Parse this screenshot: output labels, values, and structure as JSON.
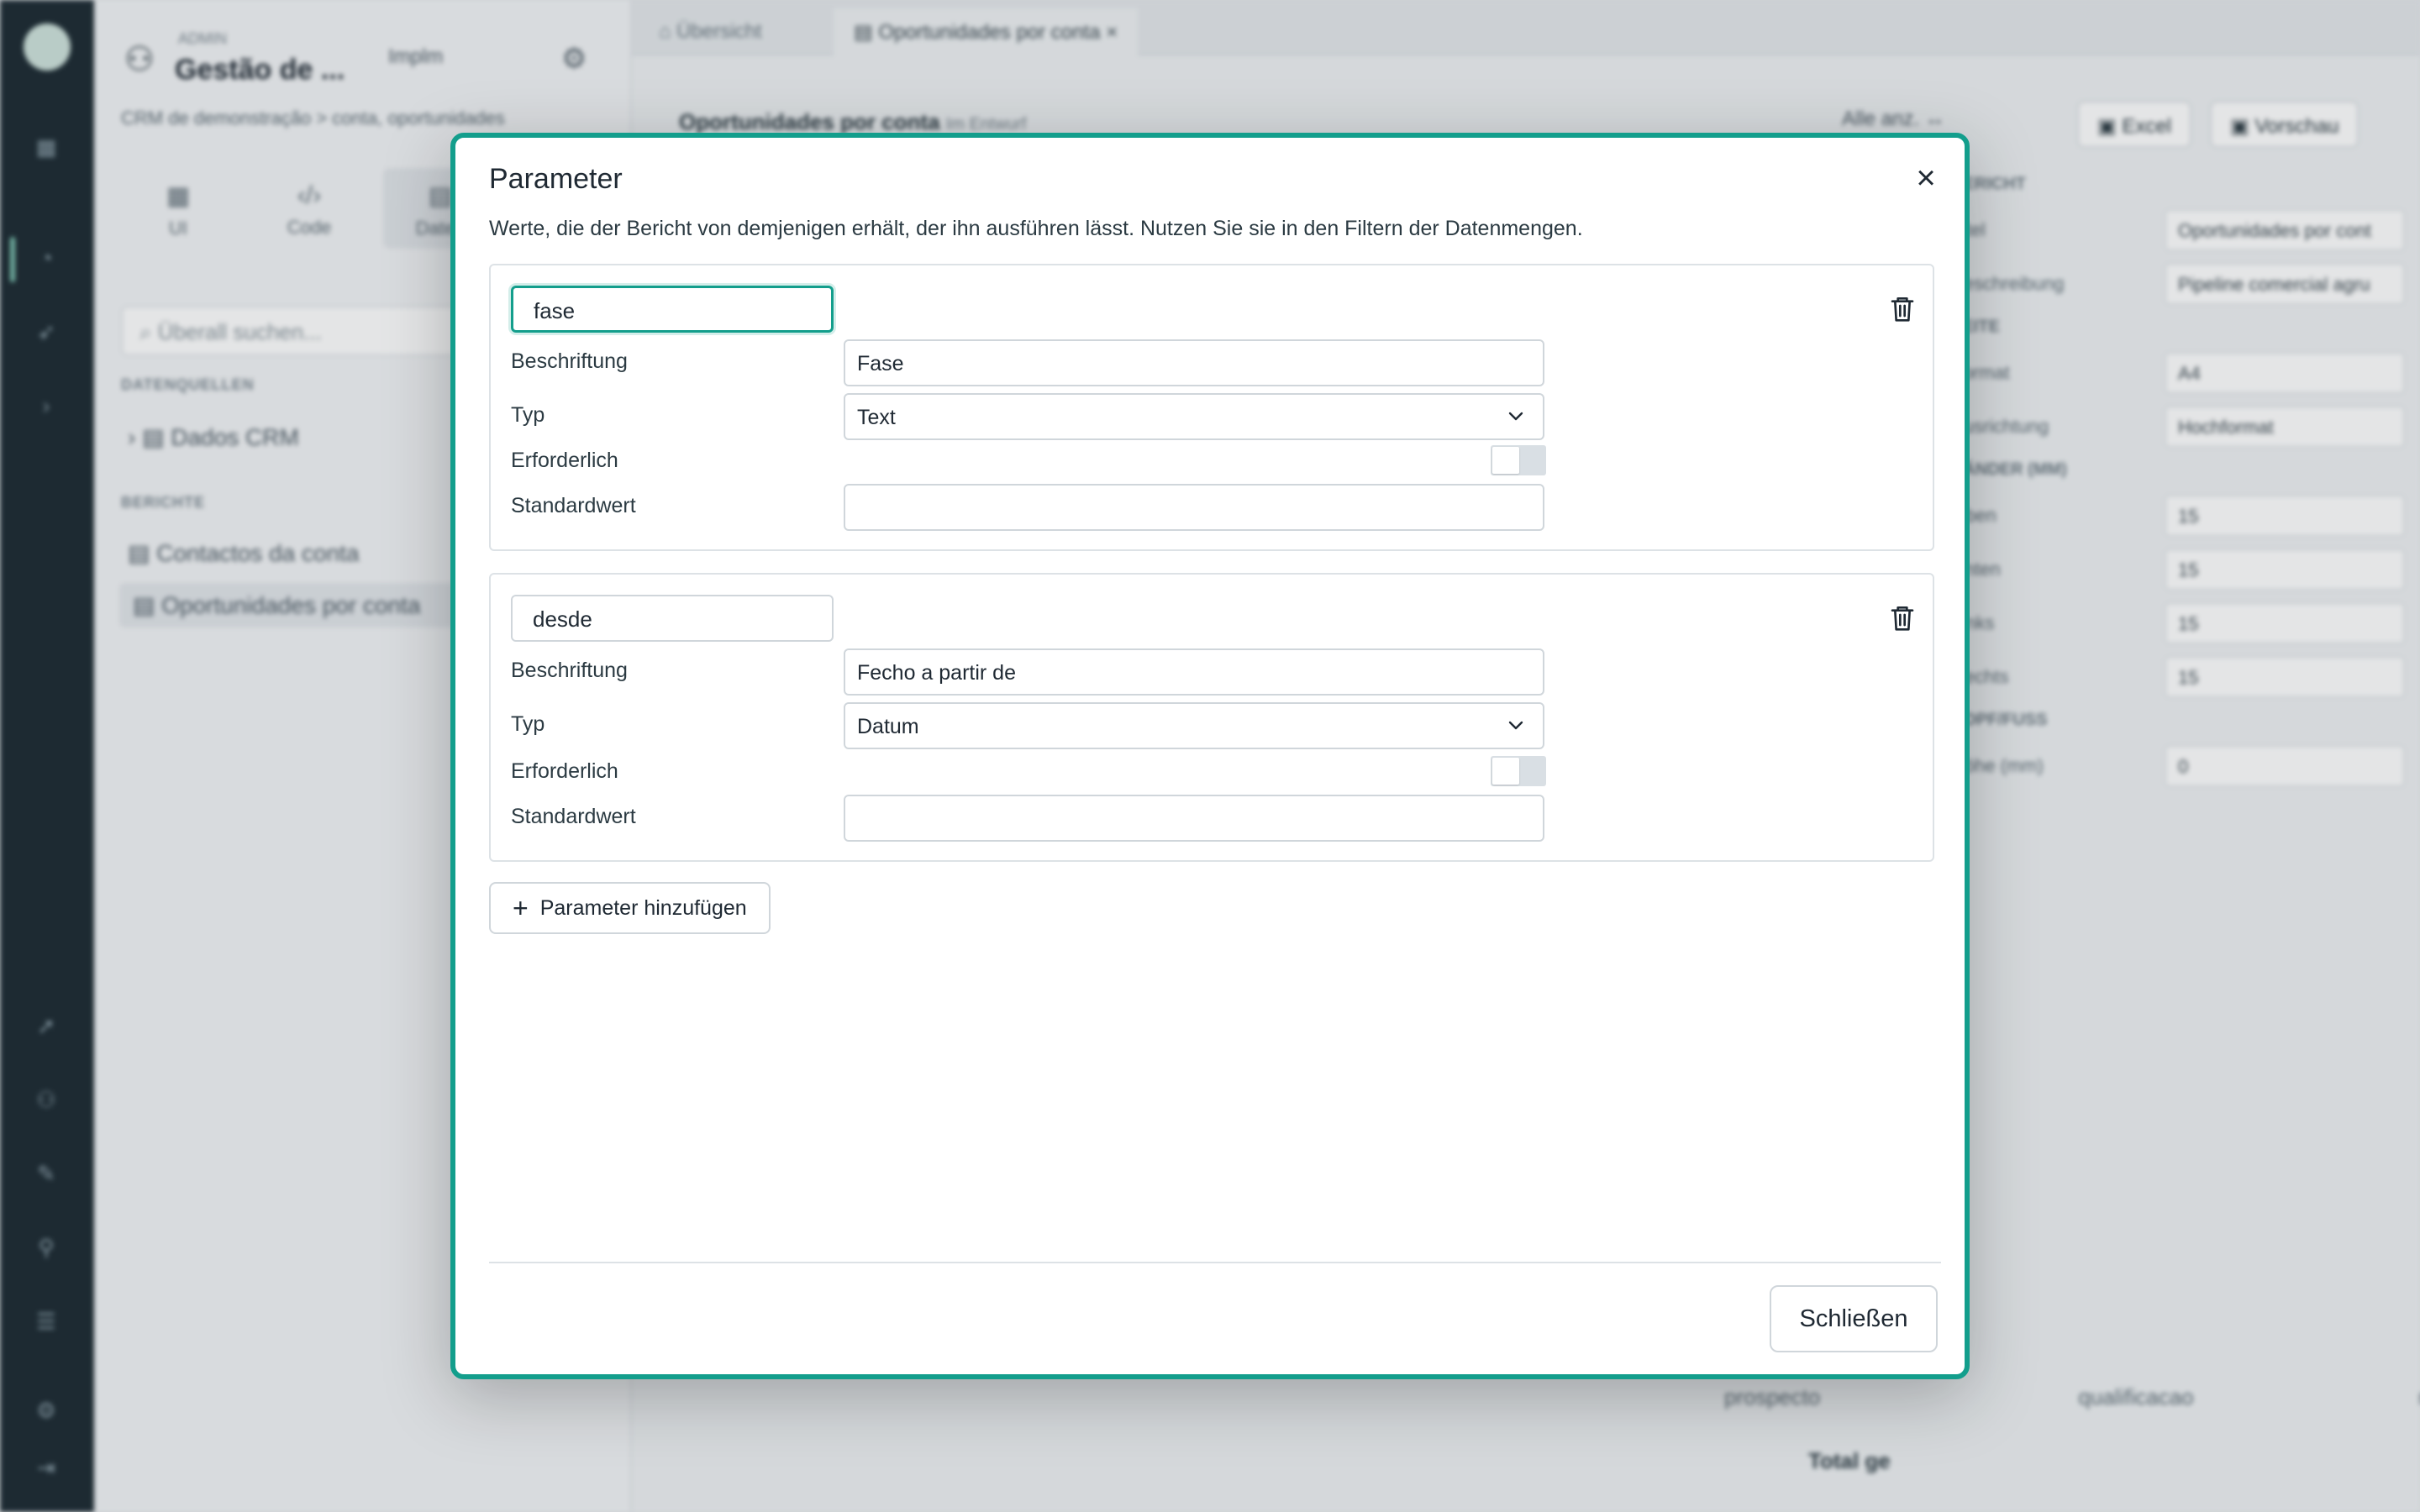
{
  "background": {
    "rail_icons": [
      "grid-icon",
      "chart-icon",
      "rocket-icon",
      "chevron-right-icon",
      "send-icon",
      "users-icon",
      "pen-icon",
      "pin-icon",
      "list-icon",
      "settings-icon",
      "logout-icon"
    ],
    "panel": {
      "small_label": "ADMIN",
      "title": "Gestão de ...",
      "chip": "Implm",
      "crumb": "CRM de demonstração > conta, oportunidades",
      "tabs": [
        {
          "icon": "▦",
          "label": "UI"
        },
        {
          "icon": "‹/›",
          "label": "Code"
        },
        {
          "icon": "▤",
          "label": "Daten"
        }
      ],
      "search_placeholder": "Überall suchen...",
      "section_sources": "DATENQUELLEN",
      "source_item": "Dados CRM",
      "section_reports": "BERICHTE",
      "report_items": [
        "Contactos da conta",
        "Oportunidades por conta"
      ]
    },
    "main": {
      "tabs": [
        "Übersicht",
        "Oportunidades por conta ×"
      ],
      "report_title": "Oportunidades por conta",
      "report_sub": "Im Entwurf",
      "toolbar_text": "Alle anz. ↔",
      "btn_excel": "Excel",
      "btn_preview": "Vorschau",
      "props": [
        {
          "head": "BERICHT"
        },
        {
          "label": "Titel",
          "value": "Oportunidades por cont"
        },
        {
          "label": "Beschreibung",
          "value": "Pipeline comercial agru"
        },
        {
          "head": "SEITE"
        },
        {
          "label": "Format",
          "value": "A4"
        },
        {
          "label": "Ausrichtung",
          "value": "Hochformat"
        },
        {
          "head": "RÄNDER (MM)"
        },
        {
          "label": "Oben",
          "value": "15"
        },
        {
          "label": "Unten",
          "value": "15"
        },
        {
          "label": "Links",
          "value": "15"
        },
        {
          "label": "Rechts",
          "value": "15"
        },
        {
          "head": "KOPF/FUSS"
        },
        {
          "label": "Höhe (mm)",
          "value": "0"
        }
      ],
      "footer_cols": [
        "prospecto",
        "qualificacao",
        "neyo"
      ],
      "footer_total": "Total ge"
    }
  },
  "modal": {
    "title": "Parameter",
    "description": "Werte, die der Bericht von demjenigen erhält, der ihn ausführen lässt. Nutzen Sie sie in den Filtern der Datenmengen.",
    "labels": {
      "caption": "Beschriftung",
      "type": "Typ",
      "required": "Erforderlich",
      "default": "Standardwert"
    },
    "parameters": [
      {
        "name": "fase",
        "caption": "Fase",
        "type": "Text",
        "required": false,
        "default": ""
      },
      {
        "name": "desde",
        "caption": "Fecho a partir de",
        "type": "Datum",
        "required": false,
        "default": ""
      }
    ],
    "add_button": "Parameter hinzufügen",
    "close_button": "Schließen",
    "accent_color": "#139e8c"
  }
}
